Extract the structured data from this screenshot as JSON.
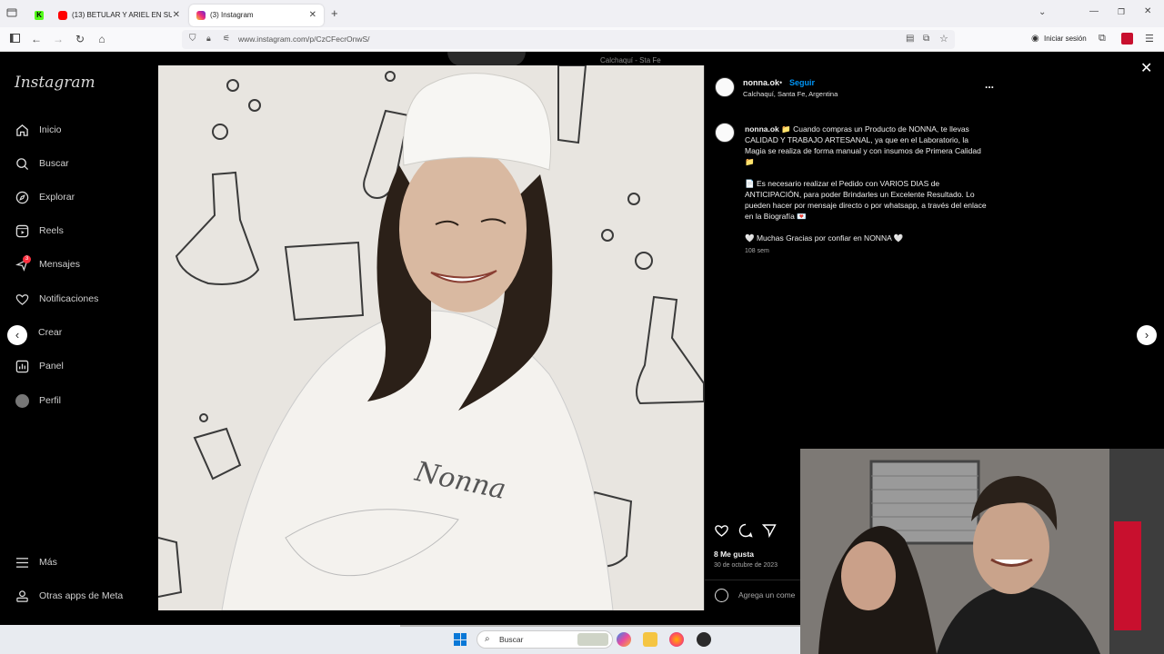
{
  "browser": {
    "tabs": [
      {
        "label": "",
        "icon": "kick-icon",
        "color": "#53fc18"
      },
      {
        "label": "(13) BETULAR Y ARIEL EN SU S/",
        "icon": "youtube-icon",
        "color": "#ff0000"
      },
      {
        "label": "(3) Instagram",
        "icon": "instagram-icon",
        "color": "#e1306c"
      }
    ],
    "new_tab": "+",
    "url": "www.instagram.com/p/CzCFecrOnwS/",
    "login_label": "Iniciar sesión"
  },
  "sidebar": {
    "logo": "Instagram",
    "items": [
      {
        "label": "Inicio",
        "icon": "home-icon"
      },
      {
        "label": "Buscar",
        "icon": "search-icon"
      },
      {
        "label": "Explorar",
        "icon": "compass-icon"
      },
      {
        "label": "Reels",
        "icon": "reels-icon"
      },
      {
        "label": "Mensajes",
        "icon": "messenger-icon",
        "badge": "3"
      },
      {
        "label": "Notificaciones",
        "icon": "heart-icon"
      },
      {
        "label": "Crear",
        "icon": "plus-icon"
      },
      {
        "label": "Panel",
        "icon": "dashboard-icon"
      },
      {
        "label": "Perfil",
        "icon": "avatar-icon"
      }
    ],
    "more_label": "Más",
    "meta_label": "Otras apps de Meta"
  },
  "post": {
    "username": "nonna.ok",
    "separator": "•",
    "follow_label": "Seguir",
    "location": "Calchaquí, Santa Fe, Argentina",
    "options": "...",
    "caption_user": "nonna.ok",
    "caption_p1": "📁 Cuando compras un Producto de NONNA, te llevas CALIDAD Y TRABAJO ARTESANAL, ya que en el Laboratorio, la Magia se realiza de forma manual y con insumos de Primera Calidad 📁",
    "caption_p2": "📄 Es necesario realizar el Pedido con VARIOS DIAS de ANTICIPACIÓN, para poder Brindarles un Excelente Resultado. Lo pueden hacer por mensaje directo o por whatsapp, a través del enlace en la Biografía 💌",
    "caption_p3": "🤍 Muchas Gracias por confiar en NONNA 🤍",
    "caption_age": "108 sem",
    "likes": "8 Me gusta",
    "date": "30 de octubre de 2023",
    "comment_placeholder": "Agrega un come",
    "bg_location": "Calchaquí - Sta Fe",
    "photo_signature": "Nonna"
  },
  "taskbar": {
    "search_label": "Buscar"
  },
  "colors": {
    "follow": "#0095f6",
    "badge": "#ff3040",
    "bg": "#000000"
  }
}
